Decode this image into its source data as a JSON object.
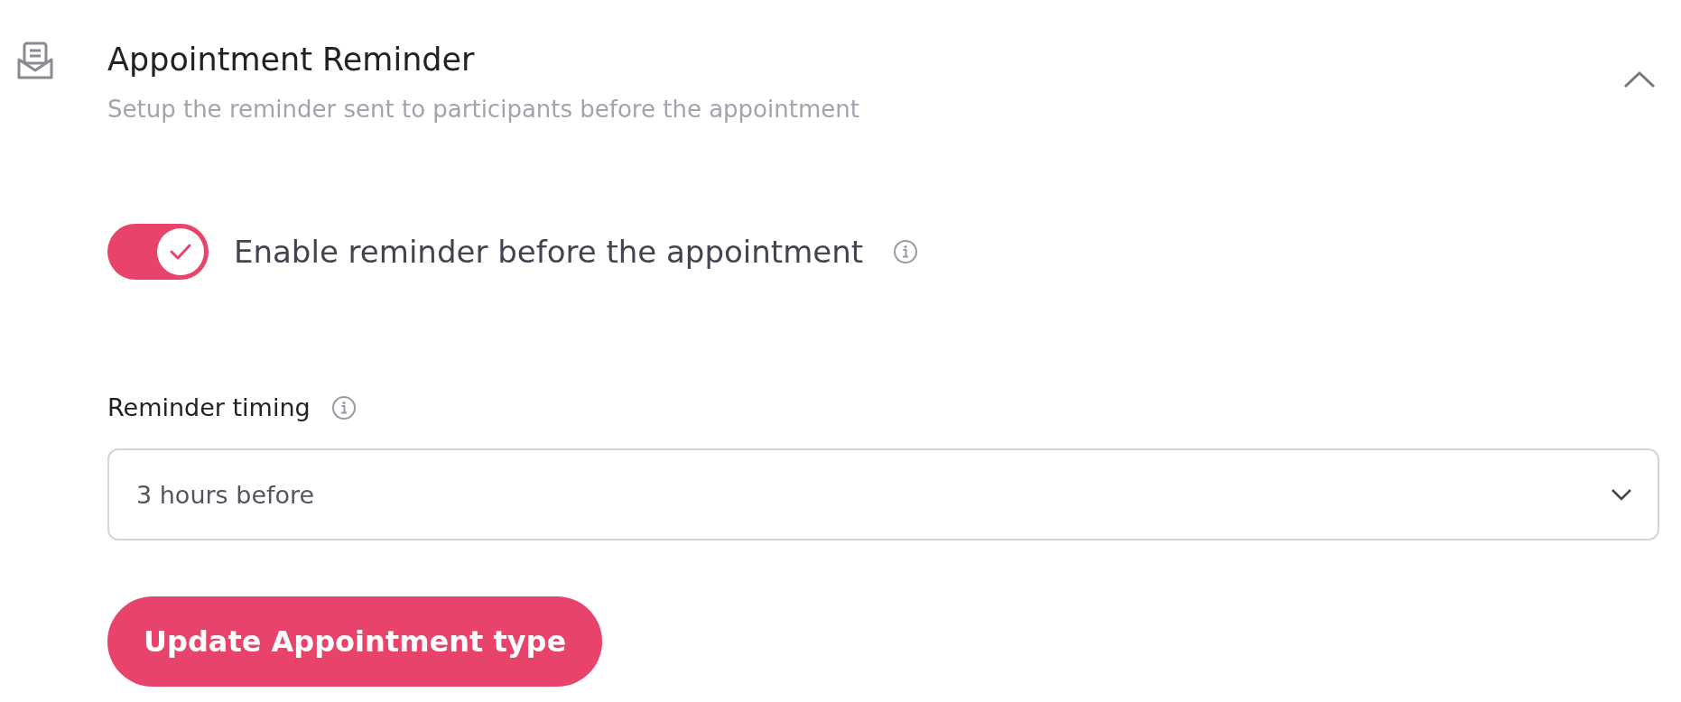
{
  "section": {
    "title": "Appointment Reminder",
    "subtitle": "Setup the reminder sent to participants before the appointment",
    "expanded": true
  },
  "toggle": {
    "label": "Enable reminder before the appointment",
    "on": true
  },
  "timing": {
    "label": "Reminder timing",
    "value": "3 hours before"
  },
  "button": {
    "label": "Update Appointment type"
  }
}
